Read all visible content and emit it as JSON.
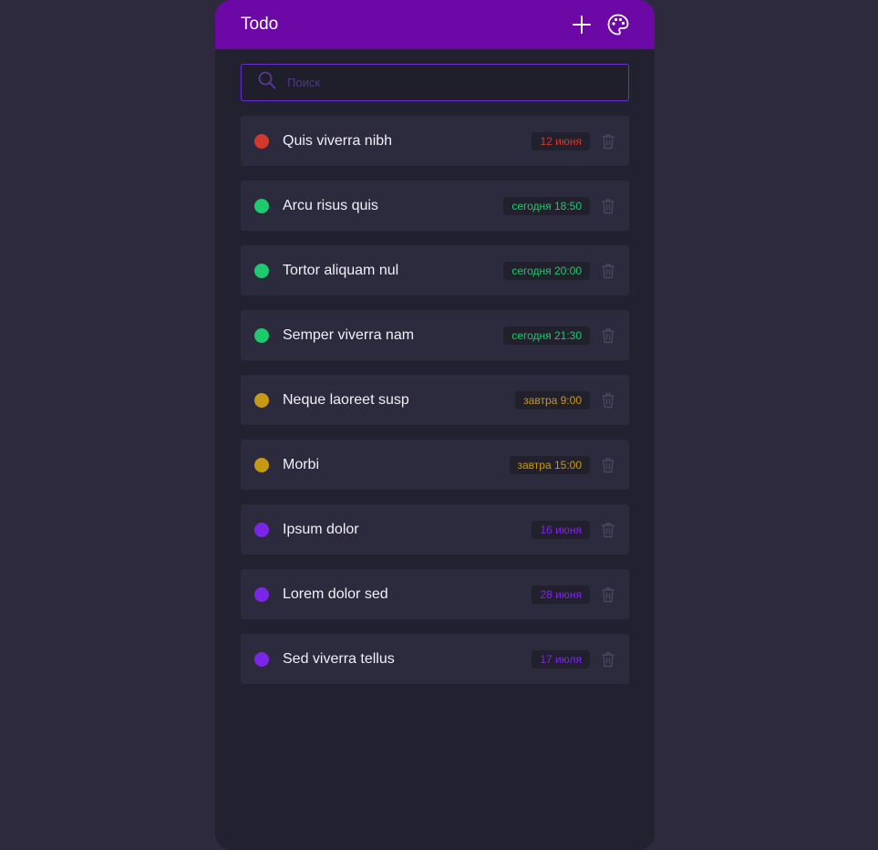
{
  "app": {
    "title": "Todo"
  },
  "header": {
    "add_icon": "plus-icon",
    "theme_icon": "palette-icon"
  },
  "search": {
    "placeholder": "Поиск",
    "value": ""
  },
  "colors": {
    "header": "#6c09a6",
    "red": "#d0392b",
    "green": "#1fc96e",
    "yellow": "#c79a16",
    "purple": "#7b26e6"
  },
  "todos": [
    {
      "title": "Quis viverra nibh",
      "date": "12 июня",
      "color": "#d0392b"
    },
    {
      "title": "Arcu risus quis",
      "date": "сегодня 18:50",
      "color": "#1fc96e"
    },
    {
      "title": "Tortor aliquam nul",
      "date": "сегодня 20:00",
      "color": "#1fc96e"
    },
    {
      "title": "Semper viverra nam",
      "date": "сегодня 21:30",
      "color": "#1fc96e"
    },
    {
      "title": "Neque laoreet susp",
      "date": "завтра 9:00",
      "color": "#c79a16"
    },
    {
      "title": "Morbi",
      "date": "завтра 15:00",
      "color": "#c79a16"
    },
    {
      "title": "Ipsum dolor",
      "date": "16 июня",
      "color": "#7b26e6"
    },
    {
      "title": "Lorem dolor sed",
      "date": "28 июня",
      "color": "#7b26e6"
    },
    {
      "title": "Sed viverra tellus",
      "date": "17 июля",
      "color": "#7b26e6"
    }
  ]
}
